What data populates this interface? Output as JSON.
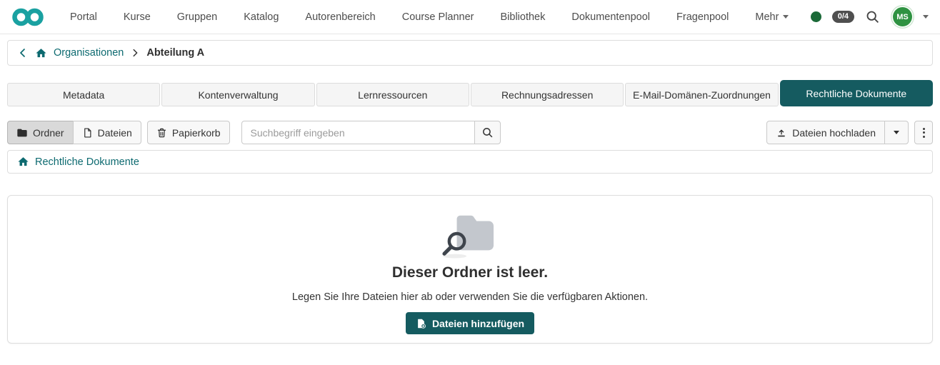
{
  "navbar": {
    "items": [
      "Portal",
      "Kurse",
      "Gruppen",
      "Katalog",
      "Autorenbereich",
      "Course Planner",
      "Bibliothek",
      "Dokumentenpool",
      "Fragenpool"
    ],
    "more_label": "Mehr",
    "task_badge": "0/4",
    "avatar_initials": "MS"
  },
  "breadcrumb": {
    "root_label": "Organisationen",
    "current_label": "Abteilung A"
  },
  "tabs": {
    "items": [
      {
        "label": "Metadata",
        "active": false
      },
      {
        "label": "Kontenverwaltung",
        "active": false
      },
      {
        "label": "Lernressourcen",
        "active": false
      },
      {
        "label": "Rechnungsadressen",
        "active": false
      },
      {
        "label": "E-Mail-Domänen-Zuordnungen",
        "active": false
      },
      {
        "label": "Rechtliche Dokumente",
        "active": true
      }
    ]
  },
  "toolbar": {
    "folder_label": "Ordner",
    "files_label": "Dateien",
    "trash_label": "Papierkorb",
    "search_placeholder": "Suchbegriff eingeben",
    "upload_label": "Dateien hochladen"
  },
  "folder_breadcrumb": {
    "root_label": "Rechtliche Dokumente"
  },
  "empty_state": {
    "title": "Dieser Ordner ist leer.",
    "description": "Legen Sie Ihre Dateien hier ab oder verwenden Sie die verfügbaren Aktionen.",
    "add_button_label": "Dateien hinzufügen"
  },
  "colors": {
    "brand_teal": "#1aa1a1",
    "dark_teal": "#155b60",
    "link_teal": "#0d6a70",
    "avatar_green": "#2e9241",
    "status_green": "#1b6a38",
    "badge_gray": "#4f4f4f"
  }
}
